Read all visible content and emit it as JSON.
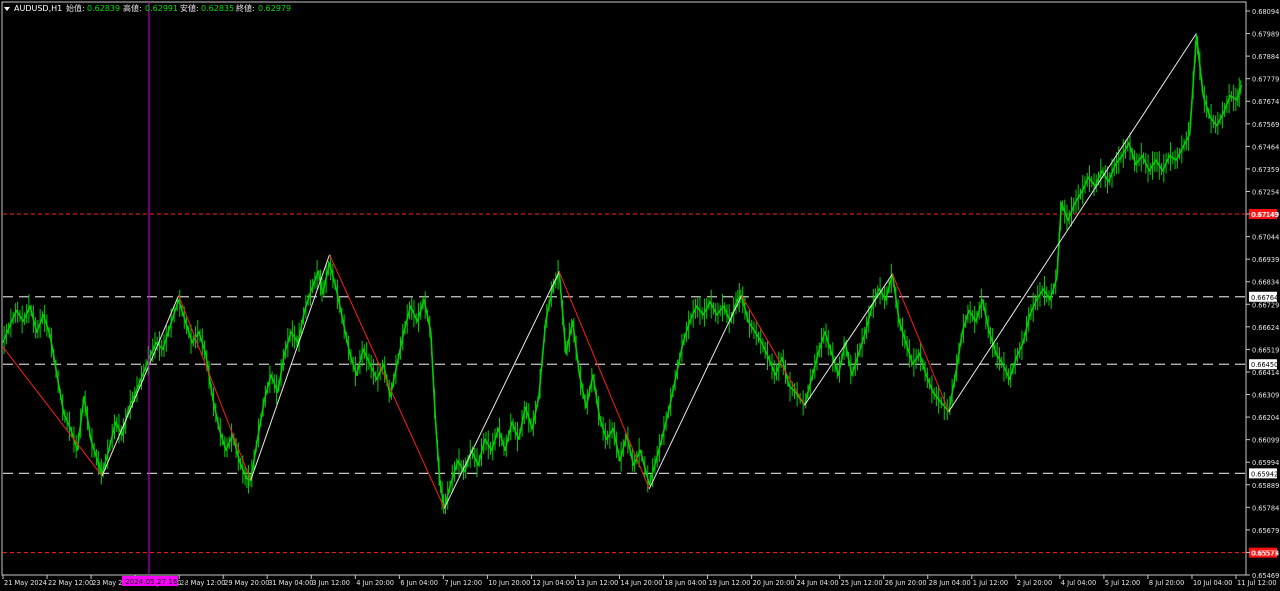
{
  "header": {
    "symbol_dropdown_icon": "triangle-down-icon",
    "symbol": "AUDUSD,H1",
    "labels": [
      {
        "name": "始值:",
        "value": "0.62839"
      },
      {
        "name": "高値:",
        "value": "0.62991"
      },
      {
        "name": "安値:",
        "value": "0.62835"
      },
      {
        "name": "終値:",
        "value": "0.62979"
      }
    ]
  },
  "colors": {
    "background": "#000000",
    "frame": "#c8c8c8",
    "candles": "#00d000",
    "zigzag_up": "#e8e8e8",
    "zigzag_down": "#ff1a1a",
    "dashed_level": "#c8c8c8",
    "red_level": "#ff2020",
    "vertical_line": "#b000c0",
    "header_value": "#00e000",
    "text": "#e6e6e6"
  },
  "time_marker": {
    "label": "2024.05.27 16:00"
  },
  "chart_data": {
    "type": "line",
    "title": "AUDUSD,H1",
    "ylim": [
      0.65469,
      0.68094
    ],
    "y_ticks": [
      "0.68094",
      "0.67989",
      "0.67884",
      "0.67779",
      "0.67674",
      "0.67569",
      "0.67464",
      "0.67359",
      "0.67254",
      "0.67149",
      "0.67044",
      "0.66939",
      "0.66834",
      "0.66729",
      "0.66624",
      "0.66519",
      "0.66414",
      "0.66309",
      "0.66204",
      "0.66099",
      "0.65994",
      "0.65889",
      "0.65784",
      "0.65679",
      "0.65574",
      "0.65469"
    ],
    "x_ticks": [
      "21 May 2024",
      "22 May 12:00",
      "23 May 20:00",
      "27 May 04:00",
      "28 May 12:00",
      "29 May 20:00",
      "31 May 04:00",
      "3 Jun 12:00",
      "4 Jun 20:00",
      "6 Jun 04:00",
      "7 Jun 12:00",
      "10 Jun 20:00",
      "12 Jun 04:00",
      "13 Jun 12:00",
      "14 Jun 20:00",
      "18 Jun 04:00",
      "19 Jun 12:00",
      "20 Jun 20:00",
      "24 Jun 04:00",
      "25 Jun 12:00",
      "26 Jun 20:00",
      "28 Jun 04:00",
      "1 Jul 12:00",
      "2 Jul 20:00",
      "4 Jul 04:00",
      "5 Jul 12:00",
      "8 Jul 20:00",
      "10 Jul 04:00",
      "11 Jul 12:00"
    ],
    "horizontal_levels": [
      {
        "value": 0.67149,
        "label": "0.67149",
        "style": "red-dashed"
      },
      {
        "value": 0.66764,
        "label": "0.66764",
        "style": "gray-dashed"
      },
      {
        "value": 0.6645,
        "label": "0.66450",
        "style": "gray-dashed"
      },
      {
        "value": 0.65942,
        "label": "0.65942",
        "style": "gray-dashed"
      },
      {
        "value": 0.65573,
        "label": "0.65573",
        "style": "red-dashed"
      }
    ],
    "zigzag": [
      {
        "x": 0,
        "y": 0.6653
      },
      {
        "x": 4.4,
        "y": 0.6593
      },
      {
        "x": 7.8,
        "y": 0.6677
      },
      {
        "x": 11.0,
        "y": 0.6591
      },
      {
        "x": 14.5,
        "y": 0.6696
      },
      {
        "x": 19.6,
        "y": 0.6578
      },
      {
        "x": 24.7,
        "y": 0.6688
      },
      {
        "x": 28.7,
        "y": 0.6587
      },
      {
        "x": 32.8,
        "y": 0.6677
      },
      {
        "x": 35.6,
        "y": 0.6626
      },
      {
        "x": 39.5,
        "y": 0.6687
      },
      {
        "x": 42.0,
        "y": 0.6623
      },
      {
        "x": 53.0,
        "y": 0.6799
      }
    ],
    "price_path": [
      [
        0,
        0.6655
      ],
      [
        0.3,
        0.6663
      ],
      [
        0.6,
        0.667
      ],
      [
        0.9,
        0.6665
      ],
      [
        1.2,
        0.6672
      ],
      [
        1.5,
        0.666
      ],
      [
        1.8,
        0.6668
      ],
      [
        2.1,
        0.6658
      ],
      [
        2.4,
        0.664
      ],
      [
        2.7,
        0.6622
      ],
      [
        3.0,
        0.6615
      ],
      [
        3.3,
        0.6605
      ],
      [
        3.6,
        0.663
      ],
      [
        3.9,
        0.661
      ],
      [
        4.2,
        0.66
      ],
      [
        4.4,
        0.6594
      ],
      [
        4.7,
        0.6605
      ],
      [
        5.0,
        0.6618
      ],
      [
        5.3,
        0.6612
      ],
      [
        5.6,
        0.6625
      ],
      [
        5.9,
        0.6632
      ],
      [
        6.2,
        0.664
      ],
      [
        6.5,
        0.6648
      ],
      [
        6.8,
        0.6655
      ],
      [
        7.1,
        0.6652
      ],
      [
        7.4,
        0.6662
      ],
      [
        7.8,
        0.6675
      ],
      [
        8.1,
        0.6665
      ],
      [
        8.4,
        0.6655
      ],
      [
        8.7,
        0.666
      ],
      [
        9.0,
        0.665
      ],
      [
        9.3,
        0.663
      ],
      [
        9.6,
        0.6615
      ],
      [
        9.9,
        0.6605
      ],
      [
        10.2,
        0.6612
      ],
      [
        10.5,
        0.66
      ],
      [
        10.8,
        0.6592
      ],
      [
        11.0,
        0.6591
      ],
      [
        11.3,
        0.661
      ],
      [
        11.6,
        0.6628
      ],
      [
        11.9,
        0.664
      ],
      [
        12.2,
        0.6632
      ],
      [
        12.5,
        0.665
      ],
      [
        12.8,
        0.666
      ],
      [
        13.1,
        0.6655
      ],
      [
        13.4,
        0.667
      ],
      [
        13.7,
        0.668
      ],
      [
        14.0,
        0.6688
      ],
      [
        14.2,
        0.6678
      ],
      [
        14.5,
        0.6692
      ],
      [
        14.8,
        0.668
      ],
      [
        15.1,
        0.6665
      ],
      [
        15.4,
        0.665
      ],
      [
        15.7,
        0.664
      ],
      [
        16.0,
        0.6652
      ],
      [
        16.3,
        0.6645
      ],
      [
        16.6,
        0.6638
      ],
      [
        16.9,
        0.6645
      ],
      [
        17.2,
        0.663
      ],
      [
        17.5,
        0.6645
      ],
      [
        17.8,
        0.666
      ],
      [
        18.1,
        0.6672
      ],
      [
        18.4,
        0.6665
      ],
      [
        18.7,
        0.6675
      ],
      [
        19.0,
        0.666
      ],
      [
        19.2,
        0.662
      ],
      [
        19.4,
        0.659
      ],
      [
        19.6,
        0.6578
      ],
      [
        19.9,
        0.659
      ],
      [
        20.2,
        0.66
      ],
      [
        20.5,
        0.6595
      ],
      [
        20.8,
        0.6605
      ],
      [
        21.1,
        0.6598
      ],
      [
        21.4,
        0.661
      ],
      [
        21.7,
        0.6605
      ],
      [
        22.0,
        0.6615
      ],
      [
        22.3,
        0.6605
      ],
      [
        22.6,
        0.6618
      ],
      [
        22.9,
        0.661
      ],
      [
        23.2,
        0.6625
      ],
      [
        23.5,
        0.6615
      ],
      [
        23.8,
        0.663
      ],
      [
        24.1,
        0.6665
      ],
      [
        24.4,
        0.668
      ],
      [
        24.7,
        0.6688
      ],
      [
        25.0,
        0.665
      ],
      [
        25.3,
        0.6665
      ],
      [
        25.6,
        0.664
      ],
      [
        25.9,
        0.6625
      ],
      [
        26.2,
        0.664
      ],
      [
        26.5,
        0.662
      ],
      [
        26.8,
        0.661
      ],
      [
        27.1,
        0.6615
      ],
      [
        27.4,
        0.66
      ],
      [
        27.7,
        0.6612
      ],
      [
        28.0,
        0.6598
      ],
      [
        28.3,
        0.6605
      ],
      [
        28.7,
        0.6589
      ],
      [
        29.0,
        0.66
      ],
      [
        29.3,
        0.6612
      ],
      [
        29.6,
        0.6625
      ],
      [
        29.9,
        0.664
      ],
      [
        30.2,
        0.6655
      ],
      [
        30.5,
        0.6665
      ],
      [
        30.8,
        0.6672
      ],
      [
        31.1,
        0.6668
      ],
      [
        31.4,
        0.6674
      ],
      [
        31.7,
        0.6668
      ],
      [
        32.0,
        0.6672
      ],
      [
        32.3,
        0.6665
      ],
      [
        32.6,
        0.6675
      ],
      [
        32.8,
        0.6677
      ],
      [
        33.1,
        0.6665
      ],
      [
        33.4,
        0.666
      ],
      [
        33.7,
        0.6655
      ],
      [
        34.0,
        0.6648
      ],
      [
        34.3,
        0.664
      ],
      [
        34.6,
        0.6648
      ],
      [
        34.9,
        0.6635
      ],
      [
        35.2,
        0.6632
      ],
      [
        35.6,
        0.6626
      ],
      [
        35.9,
        0.6638
      ],
      [
        36.2,
        0.665
      ],
      [
        36.5,
        0.666
      ],
      [
        36.8,
        0.665
      ],
      [
        37.1,
        0.664
      ],
      [
        37.4,
        0.6655
      ],
      [
        37.7,
        0.664
      ],
      [
        38.0,
        0.665
      ],
      [
        38.3,
        0.666
      ],
      [
        38.6,
        0.6672
      ],
      [
        38.9,
        0.668
      ],
      [
        39.2,
        0.6675
      ],
      [
        39.5,
        0.6687
      ],
      [
        39.8,
        0.6665
      ],
      [
        40.1,
        0.6655
      ],
      [
        40.4,
        0.6645
      ],
      [
        40.7,
        0.665
      ],
      [
        41.0,
        0.664
      ],
      [
        41.3,
        0.6632
      ],
      [
        41.6,
        0.6628
      ],
      [
        42.0,
        0.6623
      ],
      [
        42.3,
        0.664
      ],
      [
        42.6,
        0.666
      ],
      [
        42.9,
        0.667
      ],
      [
        43.2,
        0.6665
      ],
      [
        43.5,
        0.6675
      ],
      [
        43.8,
        0.666
      ],
      [
        44.1,
        0.665
      ],
      [
        44.4,
        0.6645
      ],
      [
        44.7,
        0.6638
      ],
      [
        45.0,
        0.6648
      ],
      [
        45.3,
        0.6655
      ],
      [
        45.6,
        0.6668
      ],
      [
        45.9,
        0.6675
      ],
      [
        46.2,
        0.668
      ],
      [
        46.5,
        0.6675
      ],
      [
        46.8,
        0.6685
      ],
      [
        47.0,
        0.672
      ],
      [
        47.3,
        0.6712
      ],
      [
        47.6,
        0.672
      ],
      [
        47.9,
        0.6725
      ],
      [
        48.2,
        0.6732
      ],
      [
        48.5,
        0.6728
      ],
      [
        48.8,
        0.6735
      ],
      [
        49.1,
        0.673
      ],
      [
        49.4,
        0.6738
      ],
      [
        49.7,
        0.6742
      ],
      [
        50.0,
        0.6748
      ],
      [
        50.3,
        0.6738
      ],
      [
        50.6,
        0.6742
      ],
      [
        50.9,
        0.6735
      ],
      [
        51.2,
        0.674
      ],
      [
        51.5,
        0.6735
      ],
      [
        51.8,
        0.6742
      ],
      [
        52.1,
        0.674
      ],
      [
        52.4,
        0.6746
      ],
      [
        52.7,
        0.6752
      ],
      [
        53.0,
        0.6798
      ],
      [
        53.3,
        0.677
      ],
      [
        53.6,
        0.676
      ],
      [
        53.9,
        0.6756
      ],
      [
        54.2,
        0.6762
      ],
      [
        54.5,
        0.677
      ],
      [
        54.8,
        0.6768
      ],
      [
        55.0,
        0.6775
      ]
    ]
  }
}
